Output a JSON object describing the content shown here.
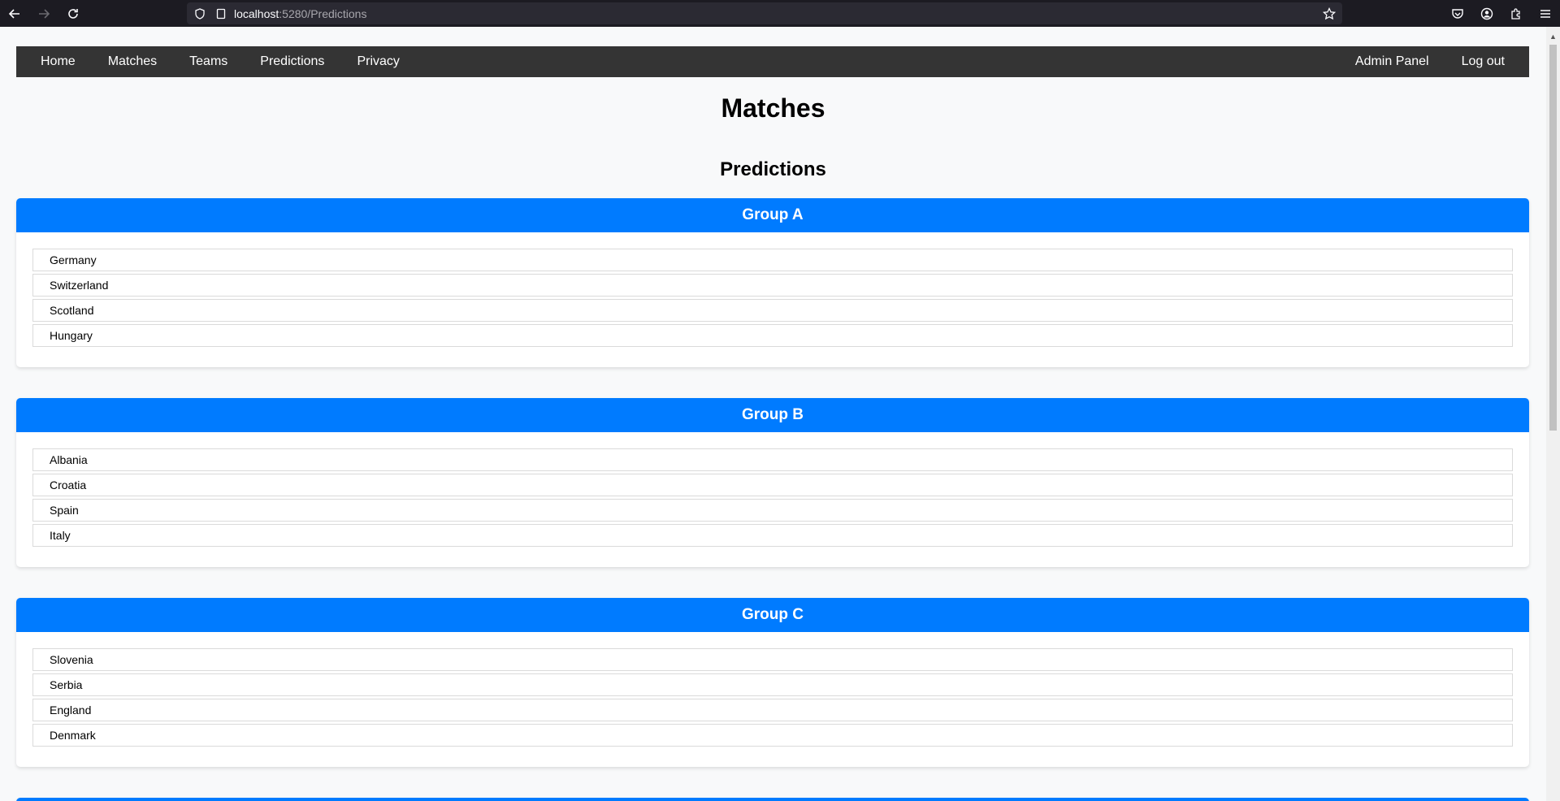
{
  "browser": {
    "url_host": "localhost",
    "url_path": ":5280/Predictions"
  },
  "nav": {
    "left": [
      "Home",
      "Matches",
      "Teams",
      "Predictions",
      "Privacy"
    ],
    "right": [
      "Admin Panel",
      "Log out"
    ]
  },
  "page": {
    "title": "Matches",
    "subtitle": "Predictions"
  },
  "groups": [
    {
      "name": "Group A",
      "teams": [
        "Germany",
        "Switzerland",
        "Scotland",
        "Hungary"
      ]
    },
    {
      "name": "Group B",
      "teams": [
        "Albania",
        "Croatia",
        "Spain",
        "Italy"
      ]
    },
    {
      "name": "Group C",
      "teams": [
        "Slovenia",
        "Serbia",
        "England",
        "Denmark"
      ]
    },
    {
      "name": "",
      "teams": []
    }
  ],
  "colors": {
    "accent": "#007bff",
    "navbar": "#343434"
  },
  "icons": [
    "back-icon",
    "forward-icon",
    "reload-icon",
    "shield-icon",
    "page-icon",
    "star-icon",
    "pocket-icon",
    "account-icon",
    "extensions-icon",
    "menu-icon"
  ]
}
